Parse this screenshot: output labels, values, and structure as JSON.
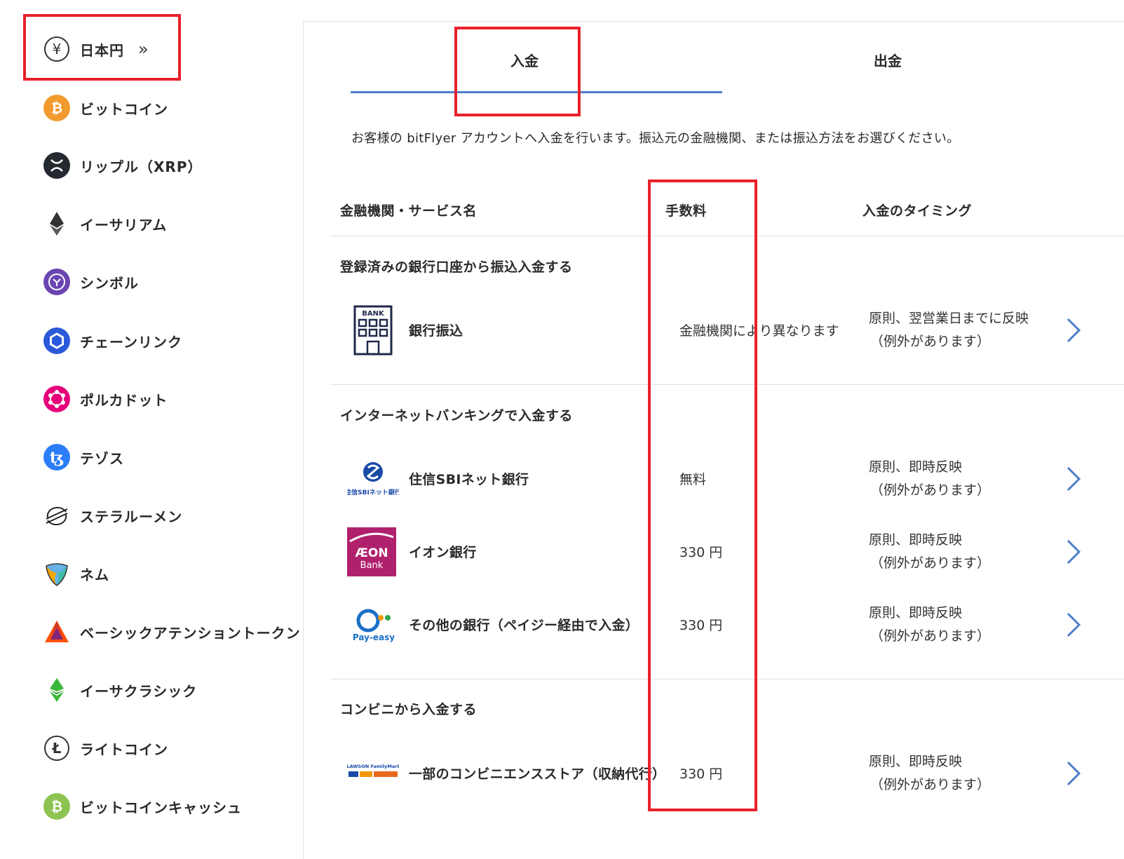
{
  "sidebar": {
    "items": [
      {
        "label": "日本円",
        "icon": "yen-icon"
      },
      {
        "label": "ビットコイン",
        "icon": "bitcoin-icon"
      },
      {
        "label": "リップル（XRP）",
        "icon": "xrp-icon"
      },
      {
        "label": "イーサリアム",
        "icon": "ethereum-icon"
      },
      {
        "label": "シンボル",
        "icon": "symbol-icon"
      },
      {
        "label": "チェーンリンク",
        "icon": "chainlink-icon"
      },
      {
        "label": "ポルカドット",
        "icon": "polkadot-icon"
      },
      {
        "label": "テゾス",
        "icon": "tezos-icon"
      },
      {
        "label": "ステラルーメン",
        "icon": "stellar-icon"
      },
      {
        "label": "ネム",
        "icon": "nem-icon"
      },
      {
        "label": "ベーシックアテンショントークン",
        "icon": "bat-icon"
      },
      {
        "label": "イーサクラシック",
        "icon": "ethereum-classic-icon"
      },
      {
        "label": "ライトコイン",
        "icon": "litecoin-icon"
      },
      {
        "label": "ビットコインキャッシュ",
        "icon": "bitcoin-cash-icon"
      }
    ]
  },
  "tabs": {
    "deposit": "入金",
    "withdraw": "出金",
    "active": "deposit"
  },
  "intro": "お客様の bitFlyer アカウントへ入金を行います。振込元の金融機関、または振込方法をお選びください。",
  "table": {
    "headers": {
      "name": "金融機関・サービス名",
      "fee": "手数料",
      "timing": "入金のタイミング"
    },
    "sections": [
      {
        "title": "登録済みの銀行口座から振込入金する",
        "rows": [
          {
            "name": "銀行振込",
            "fee": "金融機関により異なります",
            "timing1": "原則、翌営業日までに反映",
            "timing2": "（例外があります）",
            "logo_text": "BANK"
          }
        ]
      },
      {
        "title": "インターネットバンキングで入金する",
        "rows": [
          {
            "name": "住信SBIネット銀行",
            "fee": "無料",
            "timing1": "原則、即時反映",
            "timing2": "（例外があります）",
            "logo_text": "住信SBIネット銀行"
          },
          {
            "name": "イオン銀行",
            "fee": "330 円",
            "timing1": "原則、即時反映",
            "timing2": "（例外があります）",
            "logo_text": "ÆON",
            "logo_sub": "Bank"
          },
          {
            "name": "その他の銀行（ペイジー経由で入金）",
            "fee": "330 円",
            "timing1": "原則、即時反映",
            "timing2": "（例外があります）",
            "logo_text": "Pay-easy"
          }
        ]
      },
      {
        "title": "コンビニから入金する",
        "rows": [
          {
            "name": "一部のコンビニエンスストア（収納代行）",
            "fee": "330 円",
            "timing1": "原則、即時反映",
            "timing2": "（例外があります）",
            "logo_text": "LAWSON FamilyMart"
          }
        ]
      }
    ]
  },
  "colors": {
    "accent": "#4d7fc9",
    "highlight": "#e8212b",
    "aeon": "#b0216d"
  }
}
